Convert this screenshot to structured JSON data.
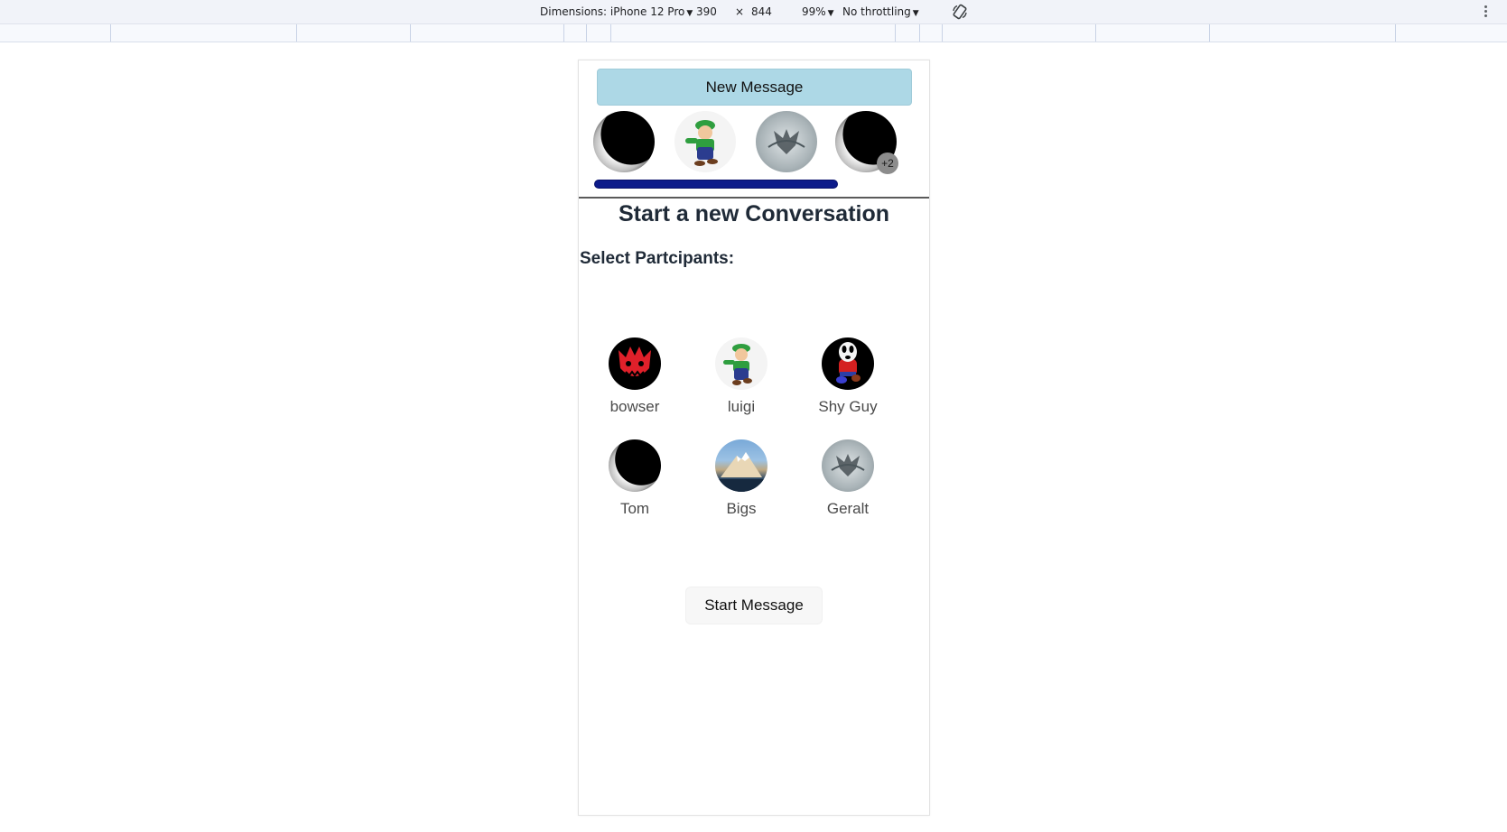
{
  "devtools": {
    "dimensions_label": "Dimensions: iPhone 12 Pro",
    "width": "390",
    "times": "×",
    "height": "844",
    "zoom": "99%",
    "throttling": "No throttling",
    "icons": [
      "chevron-down-icon",
      "rotate-icon",
      "more-vert-icon"
    ]
  },
  "app": {
    "new_message_button": "New Message",
    "selected_avatars": [
      {
        "name": "Tom",
        "icon": "moon-avatar"
      },
      {
        "name": "luigi",
        "icon": "luigi-avatar"
      },
      {
        "name": "Geralt",
        "icon": "wolf-avatar"
      },
      {
        "name": "Tom",
        "icon": "moon-avatar"
      }
    ],
    "overflow_badge": "+2",
    "title": "Start a new Conversation",
    "select_label": "Select Partcipants:",
    "participants": [
      {
        "name": "bowser"
      },
      {
        "name": "luigi"
      },
      {
        "name": "Shy Guy"
      },
      {
        "name": "Tom"
      },
      {
        "name": "Bigs"
      },
      {
        "name": "Geralt"
      }
    ],
    "start_button": "Start Message",
    "colors": {
      "new_message_bg": "#add8e6",
      "progress_bar": "#0d1b8a",
      "title_text": "#1f2a37"
    }
  }
}
